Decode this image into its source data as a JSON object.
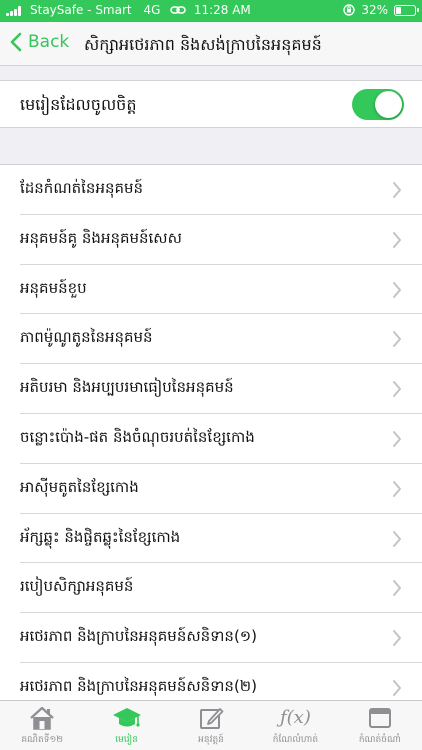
{
  "status_bar": {
    "carrier": "StaySafe - Smart",
    "network": "4G",
    "time": "11:28 AM",
    "battery": "32%",
    "battery_level": 0.32
  },
  "nav": {
    "back_label": "Back",
    "title": "សិក្សាអថេរភាព និងសង់ក្រាបនៃអនុគមន៍"
  },
  "favorite": {
    "label": "មេរៀនដែលចូលចិត្ត",
    "enabled": true
  },
  "lessons": [
    "ដែនកំណត់នៃអនុគមន៍",
    "អនុគមន៍គូ និងអនុគមន៍សេស",
    "អនុគមន៍ខួប",
    "ភាពម៉ូណូតូននៃអនុគមន៍",
    "អតិបរមា និងអប្បបរមាធៀបនៃអនុគមន៍",
    "ចន្លោះប៉ោង-ផត និងចំណុចរបត់នៃខ្សែកោង",
    "អាស៊ីមតូតនៃខ្សែកោង",
    "អ័ក្សឆ្លុះ និងផ្ចិតឆ្លុះនៃខ្សែកោង",
    "របៀបសិក្សាអនុគមន៍",
    "អថេរភាព និងក្រាបនៃអនុគមន៍សនិទាន(១)",
    "អថេរភាព និងក្រាបនៃអនុគមន៍សនិទាន(២)"
  ],
  "tabbar": {
    "tabs": [
      {
        "label": "គណិតទី១២",
        "icon": "home-icon",
        "active": false
      },
      {
        "label": "មេរៀន",
        "icon": "graduation-cap-icon",
        "active": true
      },
      {
        "label": "អនុវត្តន៍",
        "icon": "edit-icon",
        "active": false
      },
      {
        "label": "កំណែលំហាត់",
        "icon": "function-icon",
        "active": false
      },
      {
        "label": "កំណត់ចំណាំ",
        "icon": "window-icon",
        "active": false
      }
    ]
  },
  "colors": {
    "accent": "#34c759",
    "inactive": "#8e8e93"
  }
}
